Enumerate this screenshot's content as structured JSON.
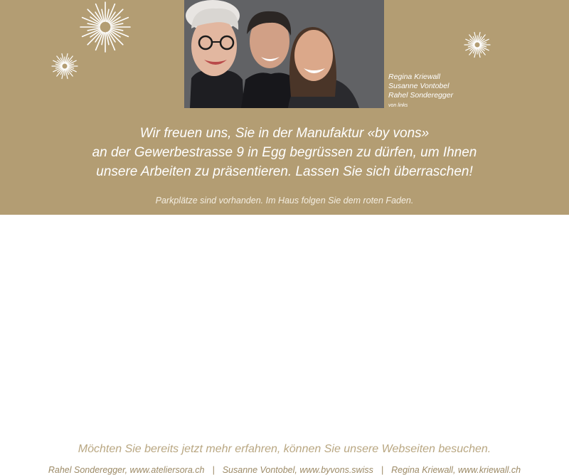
{
  "photo": {
    "alt": "Portrait of three smiling women"
  },
  "caption": {
    "names": [
      "Regina Kriewall",
      "Susanne Vontobel",
      "Rahel Sonderegger"
    ],
    "note": "von links"
  },
  "intro": {
    "lines": [
      "Wir freuen uns, Sie in der Manufaktur «by vons»",
      "an der Gewerbestrasse 9 in Egg begrüssen zu dürfen, um Ihnen",
      "unsere Arbeiten zu präsentieren. Lassen Sie sich überraschen!"
    ]
  },
  "parking": "Parkplätze sind vorhanden. Im Haus folgen Sie dem roten Faden.",
  "more": "Möchten Sie bereits jetzt mehr erfahren, können Sie unsere Webseiten besuchen.",
  "links": {
    "items": [
      "Rahel Sonderegger, www.ateliersora.ch",
      "Susanne Vontobel, www.byvons.swiss",
      "Regina Kriewall, www.kriewall.ch"
    ],
    "separator": "|"
  },
  "colors": {
    "gold_background": "#b39d73",
    "text_white": "#ffffff",
    "link_text": "#9c8a66"
  },
  "icons": [
    "starburst-icon"
  ]
}
